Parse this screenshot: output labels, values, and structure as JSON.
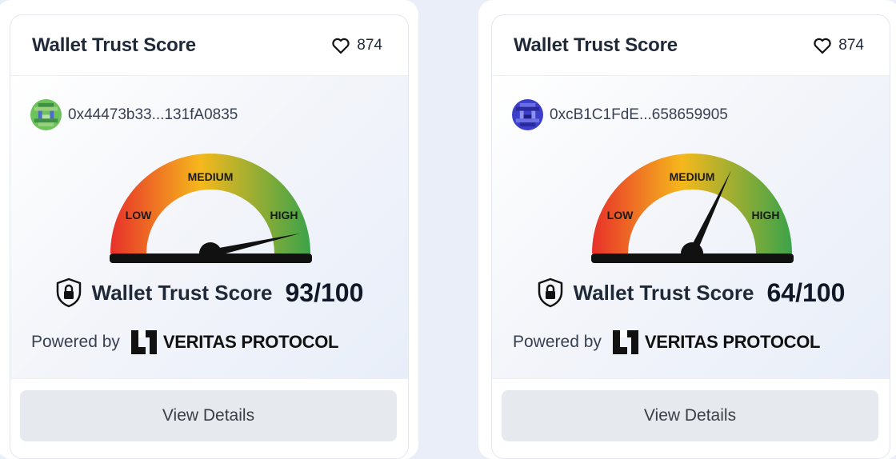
{
  "cards": [
    {
      "title": "Wallet Trust Score",
      "likes": "874",
      "address": "0x44473b33...131fA0835",
      "avatar": "green-pixel-avatar",
      "gauge": {
        "low": "LOW",
        "medium": "MEDIUM",
        "high": "HIGH"
      },
      "score_label": "Wallet Trust Score",
      "score": "93/100",
      "score_value": 93,
      "powered_label": "Powered by",
      "brand": "VERITAS PROTOCOL",
      "button": "View Details"
    },
    {
      "title": "Wallet Trust Score",
      "likes": "874",
      "address": "0xcB1C1FdE...658659905",
      "avatar": "blue-pixel-avatar",
      "gauge": {
        "low": "LOW",
        "medium": "MEDIUM",
        "high": "HIGH"
      },
      "score_label": "Wallet Trust Score",
      "score": "64/100",
      "score_value": 64,
      "powered_label": "Powered by",
      "brand": "VERITAS PROTOCOL",
      "button": "View Details"
    }
  ],
  "icons": {
    "likes": "heart-icon",
    "score": "shield-lock-icon",
    "brand": "veritas-logo"
  },
  "colors": {
    "gauge_low": "#e8302a",
    "gauge_medium": "#f5b81c",
    "gauge_high": "#3ba34a",
    "button_bg": "#e6e9ed"
  }
}
